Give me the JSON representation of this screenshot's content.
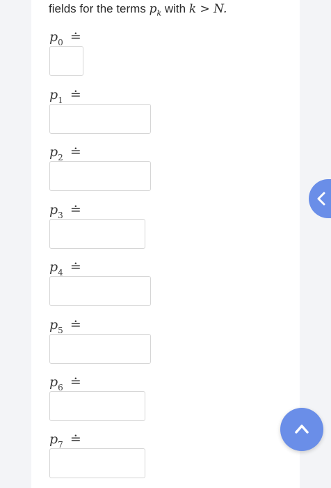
{
  "intro": {
    "text": "fields for the terms",
    "term_symbol": "p",
    "term_subscript": "k",
    "with_text": "with",
    "condition": "k > N."
  },
  "approx_symbol": "≐",
  "terms": [
    {
      "symbol": "p",
      "index": "0"
    },
    {
      "symbol": "p",
      "index": "1"
    },
    {
      "symbol": "p",
      "index": "2"
    },
    {
      "symbol": "p",
      "index": "3"
    },
    {
      "symbol": "p",
      "index": "4"
    },
    {
      "symbol": "p",
      "index": "5"
    },
    {
      "symbol": "p",
      "index": "6"
    },
    {
      "symbol": "p",
      "index": "7"
    }
  ],
  "answers": [
    "",
    "",
    "",
    "",
    "",
    "",
    "",
    ""
  ],
  "icons": {
    "side_tab": "chevron-left-icon",
    "scroll_top": "chevron-up-icon"
  },
  "colors": {
    "accent": "#6a8ee8",
    "card": "#ffffff",
    "background": "#f3f4f7"
  }
}
